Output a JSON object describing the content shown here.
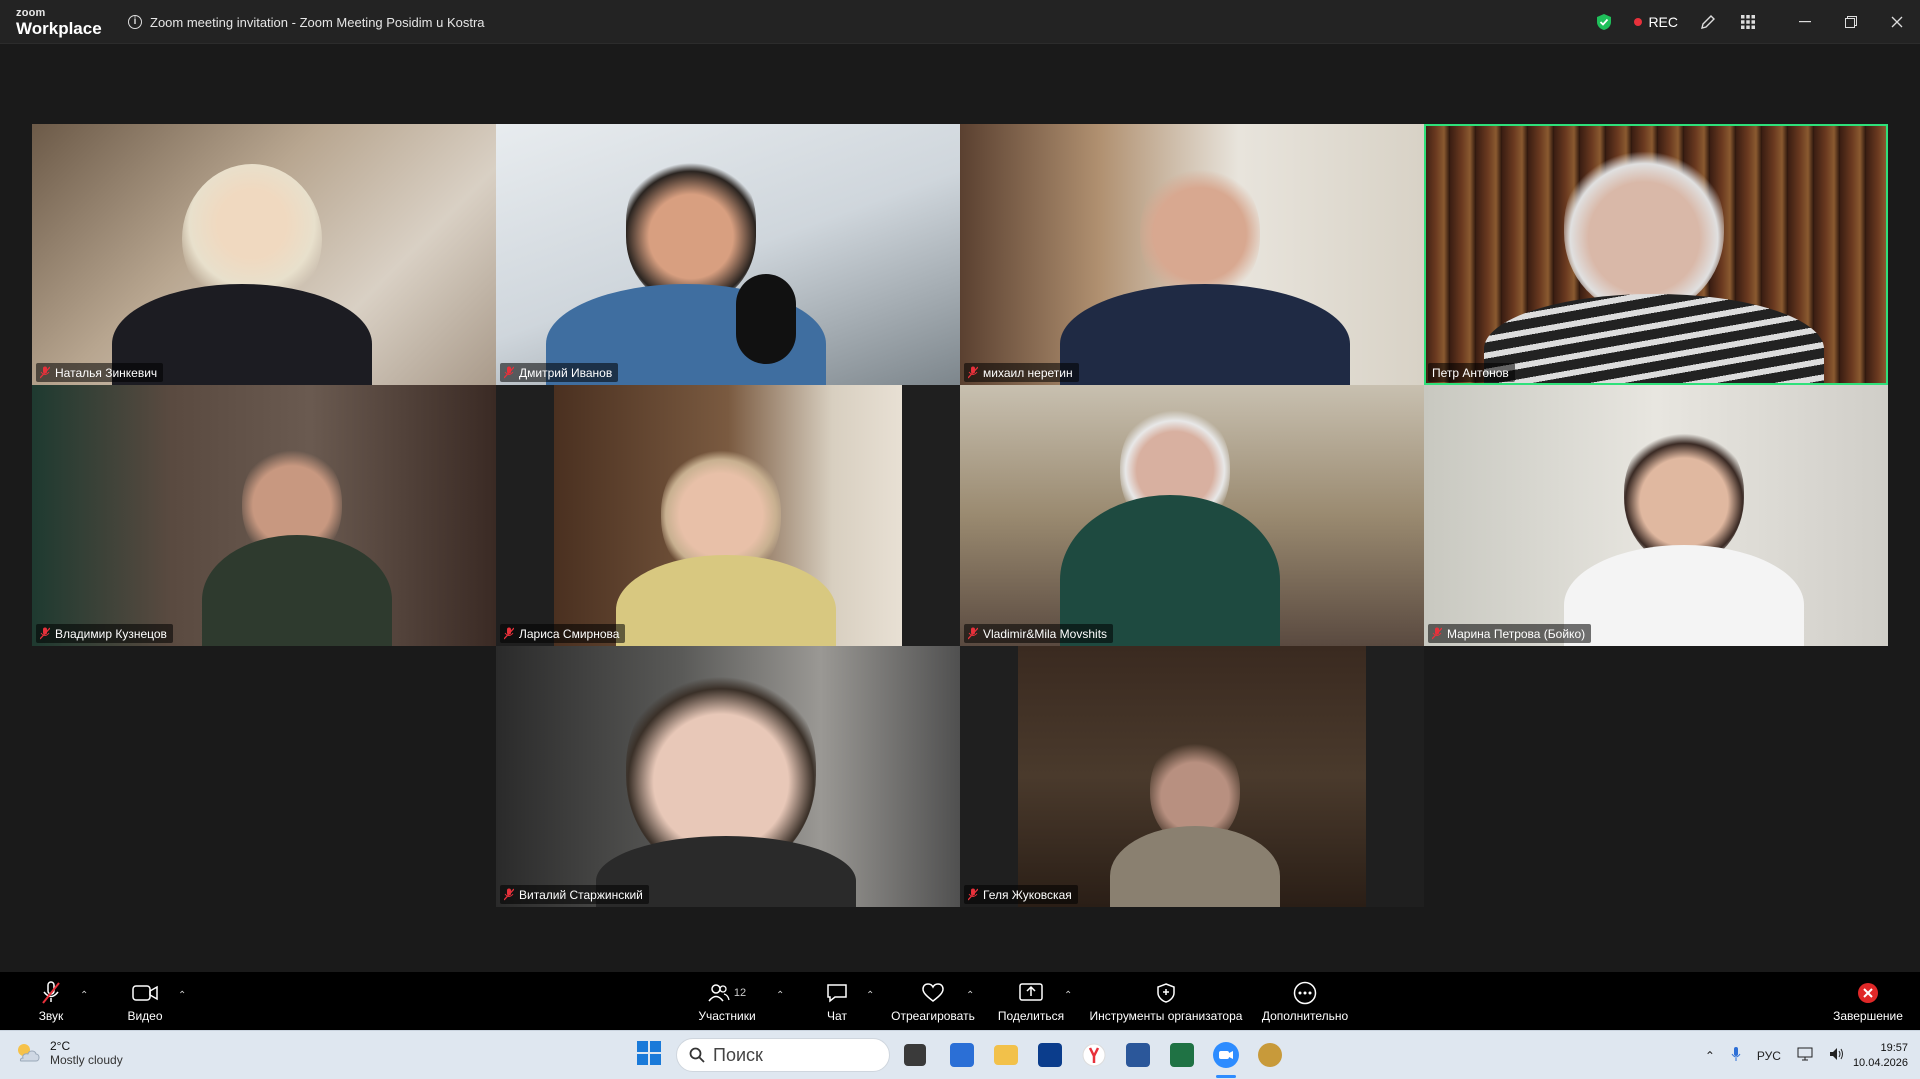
{
  "titlebar": {
    "logo_line1": "zoom",
    "logo_line2": "Workplace",
    "meeting_title": "Zoom meeting invitation - Zoom Meeting Posidim u Kostra",
    "rec_label": "REC"
  },
  "participants": [
    {
      "name": "Наталья Зинкевич",
      "muted": true,
      "active": false
    },
    {
      "name": "Дмитрий Иванов",
      "muted": true,
      "active": false
    },
    {
      "name": "михаил неретин",
      "muted": true,
      "active": false
    },
    {
      "name": "Петр Антонов",
      "muted": false,
      "active": true
    },
    {
      "name": "Владимир Кузнецов",
      "muted": true,
      "active": false
    },
    {
      "name": "Лариса Смирнова",
      "muted": true,
      "active": false
    },
    {
      "name": "Vladimir&Mila Movshits",
      "muted": true,
      "active": false
    },
    {
      "name": "Марина Петрова (Бойко)",
      "muted": true,
      "active": false
    },
    {
      "name": "Виталий Старжинский",
      "muted": true,
      "active": false
    },
    {
      "name": "Геля Жуковская",
      "muted": true,
      "active": false
    }
  ],
  "toolbar": {
    "audio": "Звук",
    "video": "Видео",
    "participants": "Участники",
    "participants_count": "12",
    "chat": "Чат",
    "react": "Отреагировать",
    "share": "Поделиться",
    "host_tools": "Инструменты организатора",
    "more": "Дополнительно",
    "end": "Завершение"
  },
  "taskbar": {
    "weather_temp": "2°C",
    "weather_desc": "Mostly cloudy",
    "search_placeholder": "Поиск",
    "lang": "РУС",
    "time": "19:57",
    "date": "10.04.2026"
  },
  "colors": {
    "active_speaker": "#2ee07a",
    "mute_red": "#e8313b",
    "end_red": "#e02828"
  }
}
